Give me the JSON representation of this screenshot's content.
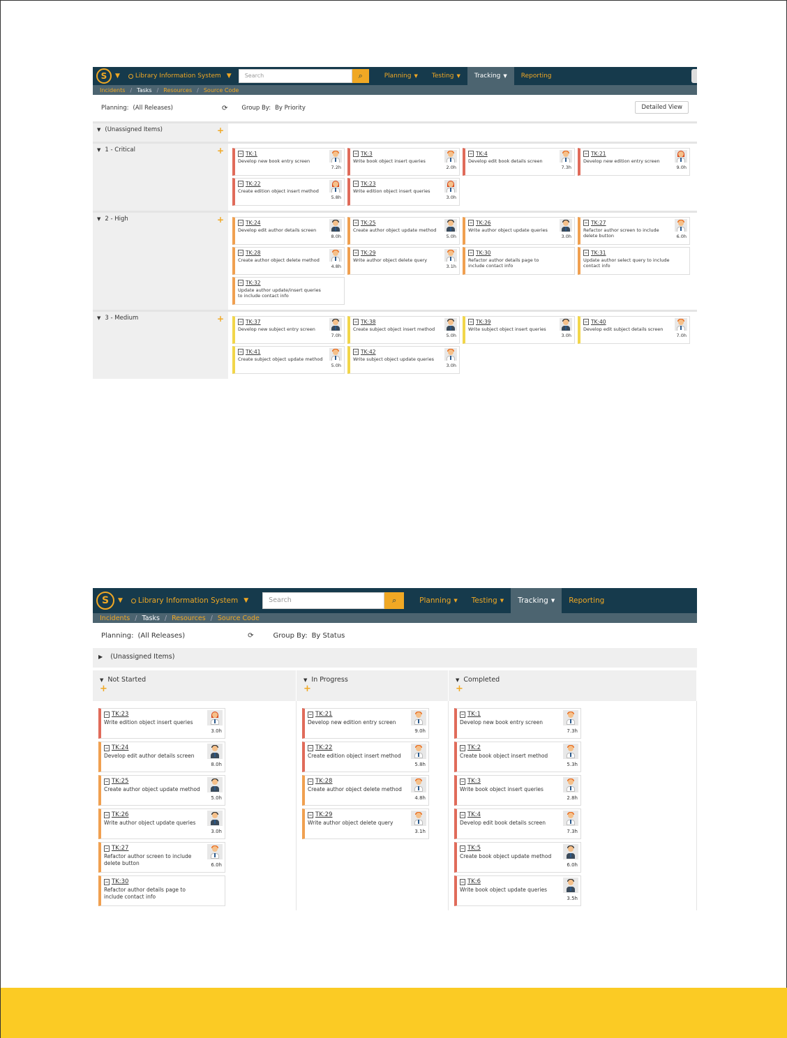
{
  "colors": {
    "nav_bg": "#163a4c",
    "accent": "#f0a824",
    "subnav_bg": "#4c6470",
    "critical": "#e06b5a",
    "high": "#f0a050",
    "medium": "#f2d64a",
    "footer": "#fbcb24"
  },
  "nav": {
    "logo": "S",
    "project": "Library Information System",
    "search_placeholder": "Search",
    "menu": [
      {
        "label": "Planning",
        "dropdown": true,
        "active": false
      },
      {
        "label": "Testing",
        "dropdown": true,
        "active": false
      },
      {
        "label": "Tracking",
        "dropdown": true,
        "active": true
      },
      {
        "label": "Reporting",
        "dropdown": false,
        "active": false
      }
    ],
    "breadcrumb": [
      "Incidents",
      "Tasks",
      "Resources",
      "Source Code"
    ],
    "breadcrumb_separator": "/"
  },
  "screen1": {
    "planning_label": "Planning:",
    "planning_value": "(All Releases)",
    "group_label": "Group By:",
    "group_value": "By Priority",
    "detailed_view": "Detailed View",
    "groups": [
      {
        "name": "(Unassigned Items)",
        "priority": "none",
        "cards": []
      },
      {
        "name": "1 - Critical",
        "priority": "critical",
        "cards": [
          {
            "id": "TK:1",
            "desc": "Develop new book entry screen",
            "hours": "7.2h",
            "avatar": "orange"
          },
          {
            "id": "TK:3",
            "desc": "Write book object insert queries",
            "hours": "2.0h",
            "avatar": "orange"
          },
          {
            "id": "TK:4",
            "desc": "Develop edit book details screen",
            "hours": "7.3h",
            "avatar": "orange"
          },
          {
            "id": "TK:21",
            "desc": "Develop new edition entry screen",
            "hours": "9.0h",
            "avatar": "red"
          },
          {
            "id": "TK:22",
            "desc": "Create edition object insert method",
            "hours": "5.8h",
            "avatar": "red"
          },
          {
            "id": "TK:23",
            "desc": "Write edition object insert queries",
            "hours": "3.0h",
            "avatar": "red"
          }
        ]
      },
      {
        "name": "2 - High",
        "priority": "high",
        "cards": [
          {
            "id": "TK:24",
            "desc": "Develop edit author details screen",
            "hours": "8.0h",
            "avatar": "dark"
          },
          {
            "id": "TK:25",
            "desc": "Create author object update method",
            "hours": "5.0h",
            "avatar": "dark"
          },
          {
            "id": "TK:26",
            "desc": "Write author object update queries",
            "hours": "3.0h",
            "avatar": "dark"
          },
          {
            "id": "TK:27",
            "desc": "Refactor author screen to include delete button",
            "hours": "6.0h",
            "avatar": "orange"
          },
          {
            "id": "TK:28",
            "desc": "Create author object delete method",
            "hours": "4.8h",
            "avatar": "orange"
          },
          {
            "id": "TK:29",
            "desc": "Write author object delete query",
            "hours": "3.1h",
            "avatar": "orange"
          },
          {
            "id": "TK:30",
            "desc": "Refactor author details page to include contact info",
            "hours": "",
            "avatar": "none"
          },
          {
            "id": "TK:31",
            "desc": "Update author select query to include contact info",
            "hours": "",
            "avatar": "none"
          },
          {
            "id": "TK:32",
            "desc": "Update author update/insert queries to include contact info",
            "hours": "",
            "avatar": "none"
          }
        ]
      },
      {
        "name": "3 - Medium",
        "priority": "medium",
        "cards": [
          {
            "id": "TK:37",
            "desc": "Develop new subject entry screen",
            "hours": "7.0h",
            "avatar": "dark"
          },
          {
            "id": "TK:38",
            "desc": "Create subject object insert method",
            "hours": "5.0h",
            "avatar": "dark"
          },
          {
            "id": "TK:39",
            "desc": "Write subject object insert queries",
            "hours": "3.0h",
            "avatar": "dark"
          },
          {
            "id": "TK:40",
            "desc": "Develop edit subject details screen",
            "hours": "7.0h",
            "avatar": "orange"
          },
          {
            "id": "TK:41",
            "desc": "Create subject object update method",
            "hours": "5.0h",
            "avatar": "orange"
          },
          {
            "id": "TK:42",
            "desc": "Write subject object update queries",
            "hours": "3.0h",
            "avatar": "orange"
          }
        ]
      }
    ]
  },
  "screen2": {
    "planning_label": "Planning:",
    "planning_value": "(All Releases)",
    "group_label": "Group By:",
    "group_value": "By Status",
    "unassigned": "(Unassigned Items)",
    "columns": [
      {
        "name": "Not Started",
        "cards": [
          {
            "id": "TK:23",
            "desc": "Write edition object insert queries",
            "hours": "3.0h",
            "avatar": "red",
            "priority": "critical"
          },
          {
            "id": "TK:24",
            "desc": "Develop edit author details screen",
            "hours": "8.0h",
            "avatar": "dark",
            "priority": "high"
          },
          {
            "id": "TK:25",
            "desc": "Create author object update method",
            "hours": "5.0h",
            "avatar": "dark",
            "priority": "high"
          },
          {
            "id": "TK:26",
            "desc": "Write author object update queries",
            "hours": "3.0h",
            "avatar": "dark",
            "priority": "high"
          },
          {
            "id": "TK:27",
            "desc": "Refactor author screen to include delete button",
            "hours": "6.0h",
            "avatar": "orange",
            "priority": "high"
          },
          {
            "id": "TK:30",
            "desc": "Refactor author details page to include contact info",
            "hours": "",
            "avatar": "none",
            "priority": "high"
          }
        ]
      },
      {
        "name": "In Progress",
        "cards": [
          {
            "id": "TK:21",
            "desc": "Develop new edition entry screen",
            "hours": "9.0h",
            "avatar": "orange",
            "priority": "critical"
          },
          {
            "id": "TK:22",
            "desc": "Create edition object insert method",
            "hours": "5.8h",
            "avatar": "orange",
            "priority": "critical"
          },
          {
            "id": "TK:28",
            "desc": "Create author object delete method",
            "hours": "4.8h",
            "avatar": "orange",
            "priority": "high"
          },
          {
            "id": "TK:29",
            "desc": "Write author object delete query",
            "hours": "3.1h",
            "avatar": "orange",
            "priority": "high"
          }
        ]
      },
      {
        "name": "Completed",
        "cards": [
          {
            "id": "TK:1",
            "desc": "Develop new book entry screen",
            "hours": "7.3h",
            "avatar": "orange",
            "priority": "critical"
          },
          {
            "id": "TK:2",
            "desc": "Create book object insert method",
            "hours": "5.3h",
            "avatar": "orange",
            "priority": "critical"
          },
          {
            "id": "TK:3",
            "desc": "Write book object insert queries",
            "hours": "2.8h",
            "avatar": "orange",
            "priority": "critical"
          },
          {
            "id": "TK:4",
            "desc": "Develop edit book details screen",
            "hours": "7.3h",
            "avatar": "orange",
            "priority": "critical"
          },
          {
            "id": "TK:5",
            "desc": "Create book object update method",
            "hours": "6.0h",
            "avatar": "dark",
            "priority": "critical"
          },
          {
            "id": "TK:6",
            "desc": "Write book object update queries",
            "hours": "3.5h",
            "avatar": "dark",
            "priority": "critical"
          }
        ]
      }
    ]
  }
}
